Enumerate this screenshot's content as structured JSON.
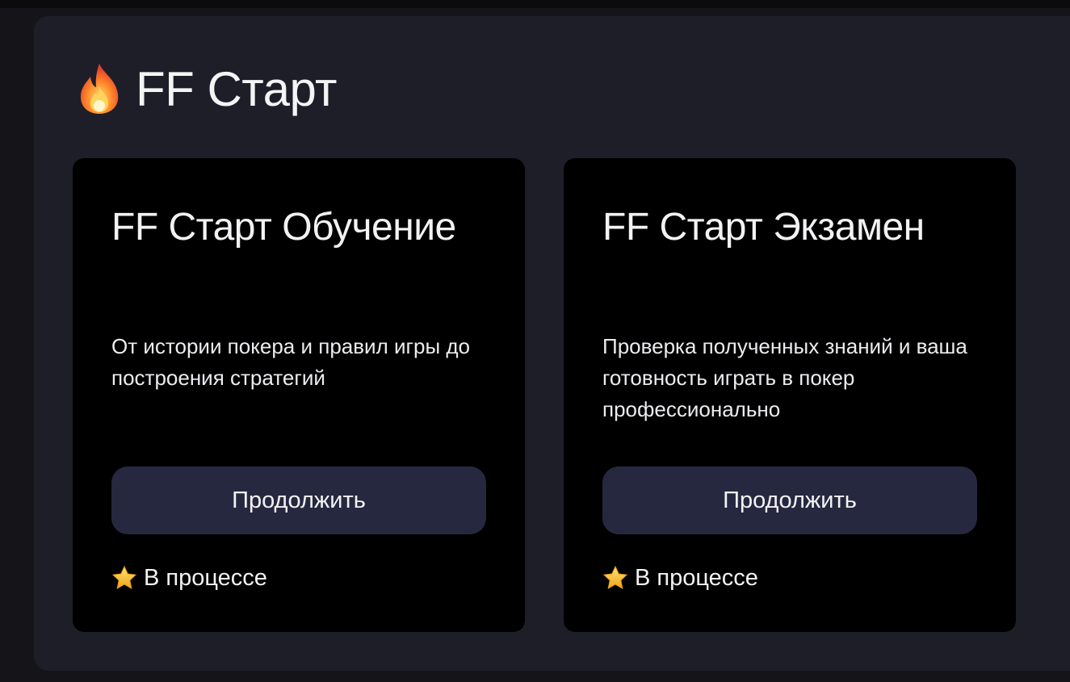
{
  "section": {
    "icon": "fire-icon",
    "title": "FF Старт"
  },
  "cards": [
    {
      "title": "FF Старт Обучение",
      "description": "От истории покера и правил игры до построения стратегий",
      "button_label": "Продолжить",
      "status_icon": "star-icon",
      "status": "В процессе"
    },
    {
      "title": "FF Старт Экзамен",
      "description": "Проверка полученных знаний и ваша готовность играть в покер профессионально",
      "button_label": "Продолжить",
      "status_icon": "star-icon",
      "status": "В процессе"
    }
  ],
  "colors": {
    "page_background": "#141419",
    "section_background": "#1e1e28",
    "card_background": "#000000",
    "button_background": "#262840",
    "text": "#f2f2f4"
  }
}
